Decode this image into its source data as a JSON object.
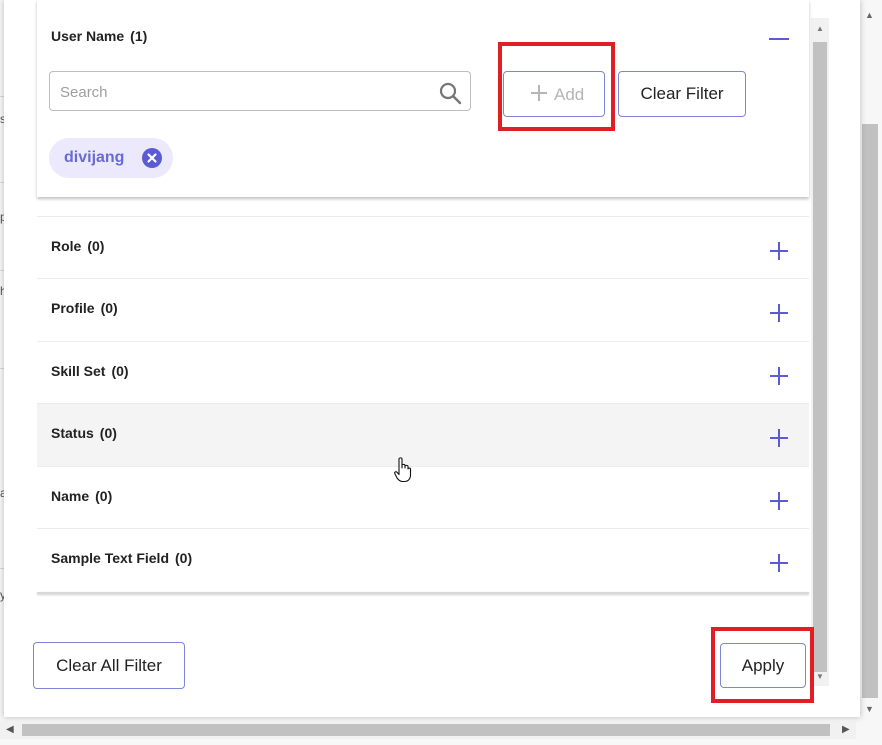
{
  "filters": {
    "expanded": {
      "title": "User Name",
      "count": "(1)",
      "search_placeholder": "Search",
      "add_label": "Add",
      "clear_filter_label": "Clear Filter",
      "chips": [
        "divijang"
      ]
    },
    "collapsed": [
      {
        "title": "Role",
        "count": "(0)"
      },
      {
        "title": "Profile",
        "count": "(0)"
      },
      {
        "title": "Skill Set",
        "count": "(0)"
      },
      {
        "title": "Status",
        "count": "(0)"
      },
      {
        "title": "Name",
        "count": "(0)"
      },
      {
        "title": "Sample Text Field",
        "count": "(0)"
      }
    ]
  },
  "footer": {
    "clear_all_label": "Clear All Filter",
    "apply_label": "Apply"
  },
  "background_glyphs": [
    "s",
    "p",
    "h",
    "a",
    "y"
  ],
  "colors": {
    "accent": "#5b5bd6",
    "chip_bg": "#ebe9fb",
    "highlight_box": "#e01e25",
    "button_border": "#7f86d8"
  }
}
